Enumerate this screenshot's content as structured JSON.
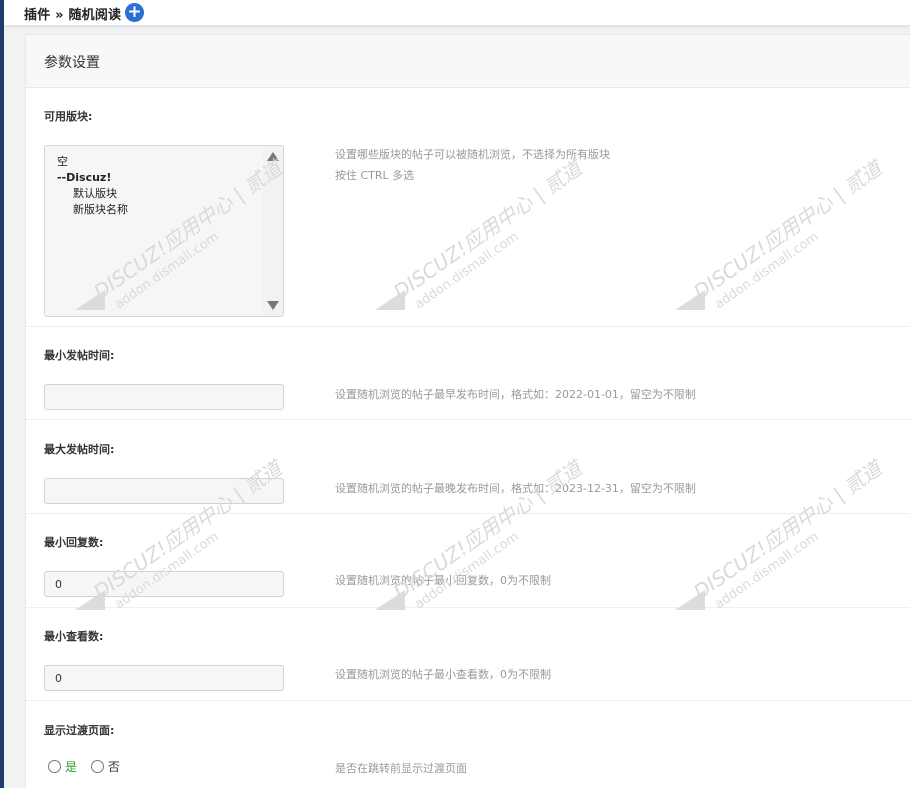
{
  "header": {
    "breadcrumb": "插件 » 随机阅读",
    "add_icon": "plus-circle-icon"
  },
  "panel": {
    "title": "参数设置"
  },
  "fields": {
    "forums": {
      "label": "可用版块:",
      "options": [
        "空",
        "--Discuz!",
        "默认版块",
        "新版块名称"
      ],
      "hint_line1": "设置哪些版块的帖子可以被随机浏览，不选择为所有版块",
      "hint_line2": "按住 CTRL 多选"
    },
    "min_time": {
      "label": "最小发帖时间:",
      "value": "",
      "hint": "设置随机浏览的帖子最早发布时间，格式如：2022-01-01，留空为不限制"
    },
    "max_time": {
      "label": "最大发帖时间:",
      "value": "",
      "hint": "设置随机浏览的帖子最晚发布时间，格式如：2023-12-31，留空为不限制"
    },
    "min_replies": {
      "label": "最小回复数:",
      "value": "0",
      "hint": "设置随机浏览的帖子最小回复数，0为不限制"
    },
    "min_views": {
      "label": "最小查看数:",
      "value": "0",
      "hint": "设置随机浏览的帖子最小查看数，0为不限制"
    },
    "transition": {
      "label": "显示过渡页面:",
      "option_yes": "是",
      "option_no": "否",
      "hint": "是否在跳转前显示过渡页面"
    }
  },
  "watermark": {
    "line1": "DISCUZ!应用中心 | 贰道",
    "line2": "addon.dismall.com",
    "color": "#d8d8d8"
  },
  "colors": {
    "accent": "#2a6fd6",
    "yes_green": "#2fa12f",
    "sidebar_edge": "#1e3d6b"
  }
}
